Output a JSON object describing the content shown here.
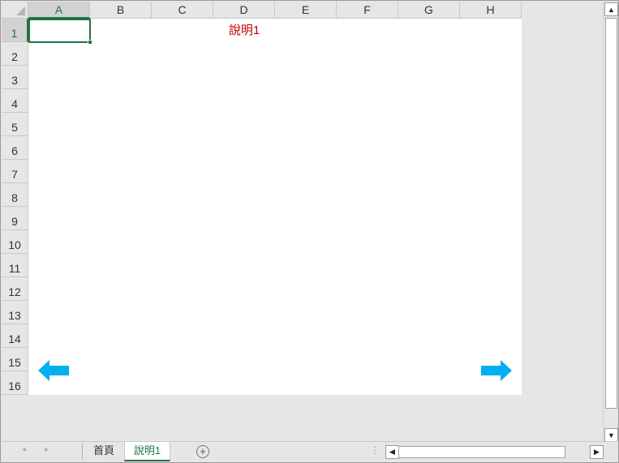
{
  "columns": [
    "A",
    "B",
    "C",
    "D",
    "E",
    "F",
    "G",
    "H"
  ],
  "rows": [
    "1",
    "2",
    "3",
    "4",
    "5",
    "6",
    "7",
    "8",
    "9",
    "10",
    "11",
    "12",
    "13",
    "14",
    "15",
    "16"
  ],
  "selected_cell": "A1",
  "cells": {
    "D1": "說明1"
  },
  "colors": {
    "accent": "#217346",
    "header_text_red": "#c00000",
    "arrow": "#00b0f0"
  },
  "sheet_tabs": [
    {
      "label": "首頁",
      "active": false
    },
    {
      "label": "說明1",
      "active": true
    }
  ],
  "icons": {
    "nav_prev": "◂",
    "nav_next": "▸",
    "add_sheet": "+",
    "scroll_up": "▲",
    "scroll_down": "▼",
    "scroll_left": "◀",
    "scroll_right": "▶",
    "more": "⋮"
  }
}
